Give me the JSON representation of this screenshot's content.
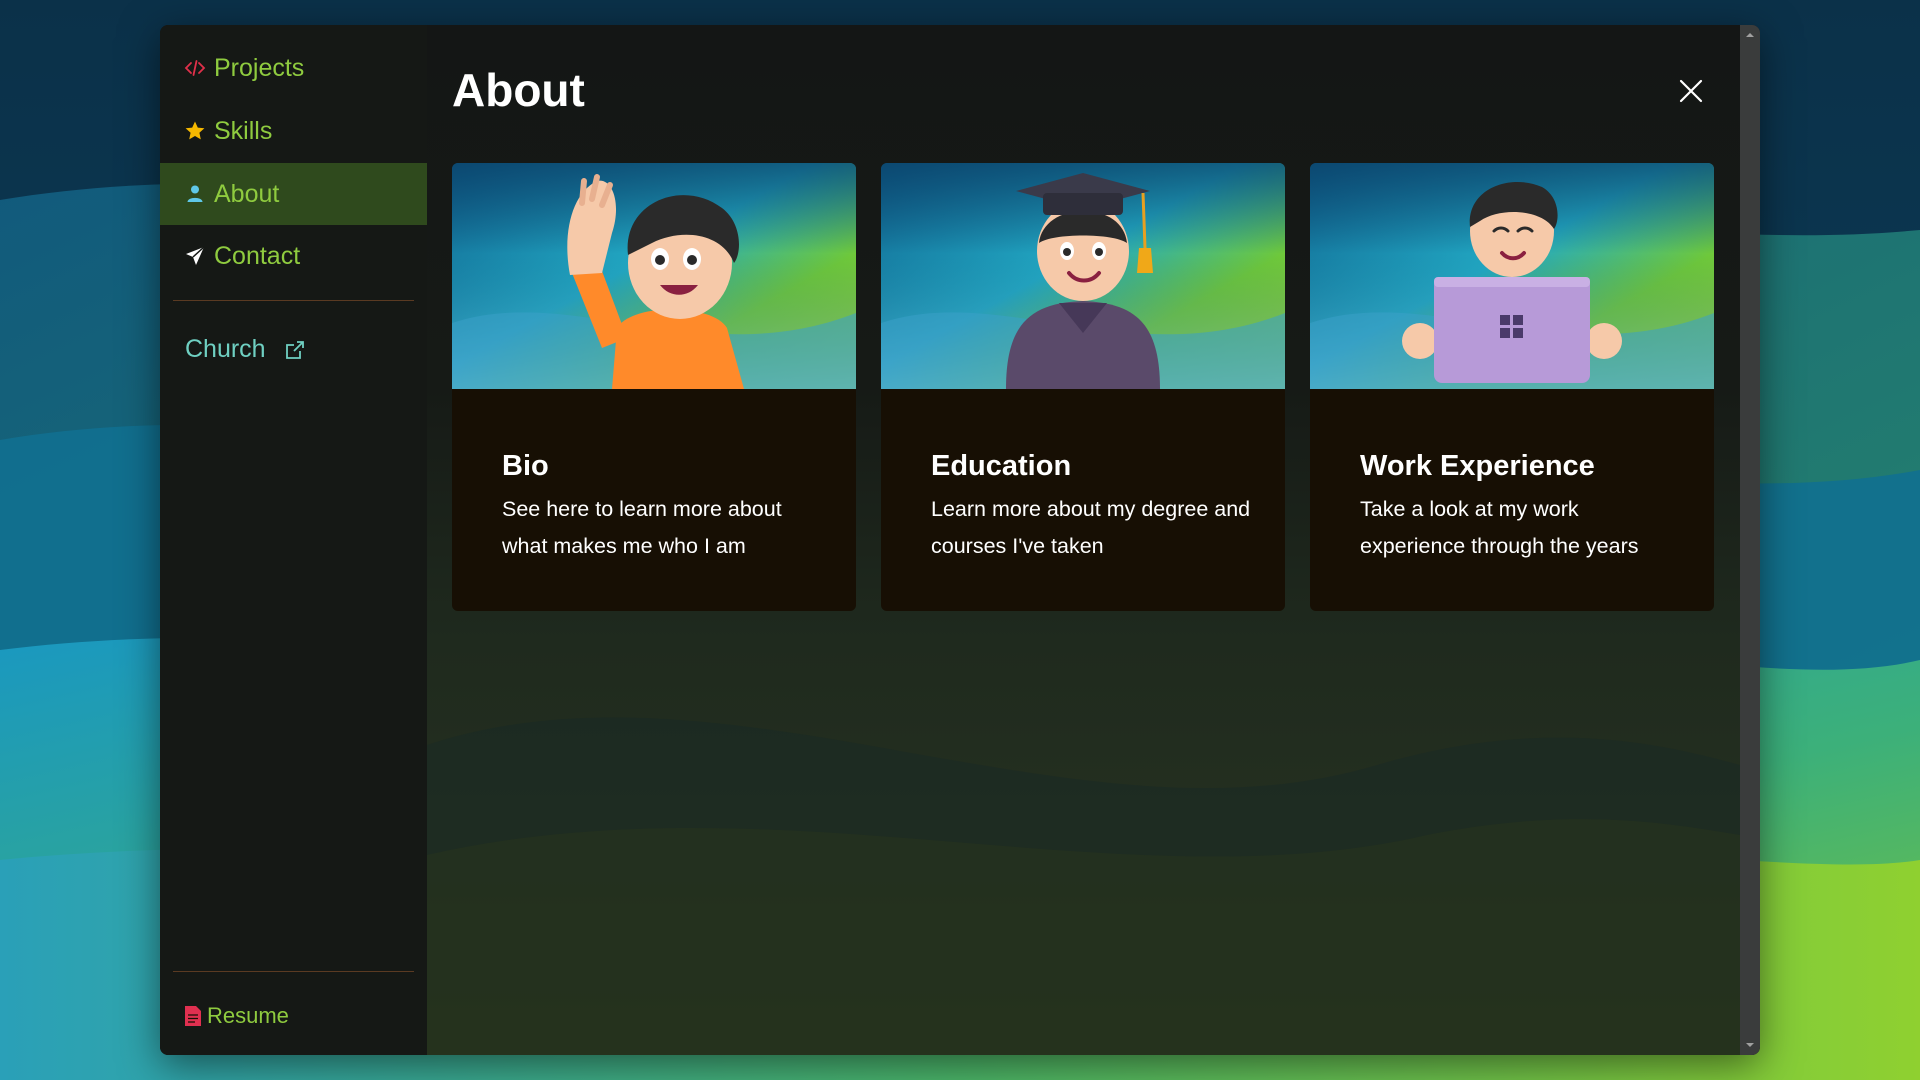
{
  "colors": {
    "accent_green": "#8fcb3f",
    "active_bg": "#2f4a1d",
    "church_teal": "#6fd0c2",
    "projects_icon": "#e0304a",
    "skills_icon": "#f5b800",
    "about_icon": "#5fc8e8",
    "resume_icon": "#e03050",
    "card_bg": "#170f04"
  },
  "sidebar": {
    "items": [
      {
        "label": "Projects",
        "icon": "code-icon"
      },
      {
        "label": "Skills",
        "icon": "star-icon"
      },
      {
        "label": "About",
        "icon": "person-icon",
        "active": true
      },
      {
        "label": "Contact",
        "icon": "paper-plane-icon"
      }
    ],
    "external": {
      "label": "Church",
      "icon": "external-link-icon"
    },
    "resume": {
      "label": "Resume",
      "icon": "document-icon"
    }
  },
  "main": {
    "title": "About",
    "close_icon": "close-icon",
    "cards": [
      {
        "title": "Bio",
        "description": "See here to learn more about what makes me who I am",
        "image": "waving-person-emoji"
      },
      {
        "title": "Education",
        "description": "Learn more about my degree and courses I've taken",
        "image": "graduate-emoji"
      },
      {
        "title": "Work Experience",
        "description": "Take a look at my work experience through the years",
        "image": "person-with-laptop-emoji"
      }
    ]
  }
}
